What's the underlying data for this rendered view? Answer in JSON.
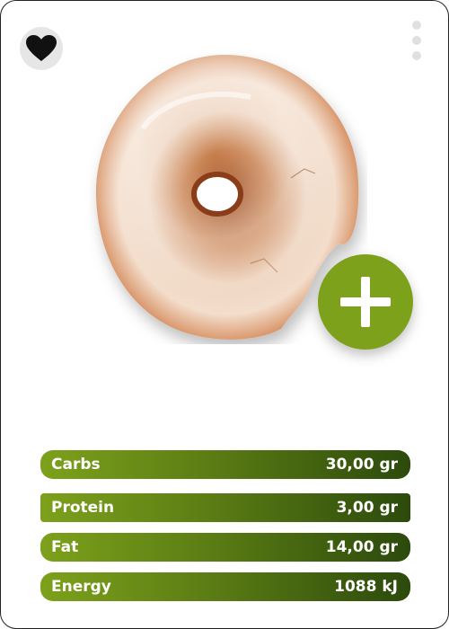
{
  "actions": {
    "favorite_icon": "heart-icon",
    "menu_icon": "more-vertical-icon",
    "add_icon": "plus-icon"
  },
  "colors": {
    "accent": "#7da11b",
    "bar_start": "#7da11b",
    "bar_end": "#2c4a0c",
    "favorite_bg": "#e6e6e6"
  },
  "nutrition": [
    {
      "label": "Carbs",
      "value": "30,00 gr"
    },
    {
      "label": "Protein",
      "value": "3,00 gr"
    },
    {
      "label": "Fat",
      "value": "14,00 gr"
    },
    {
      "label": "Energy",
      "value": "1088 kJ"
    }
  ]
}
